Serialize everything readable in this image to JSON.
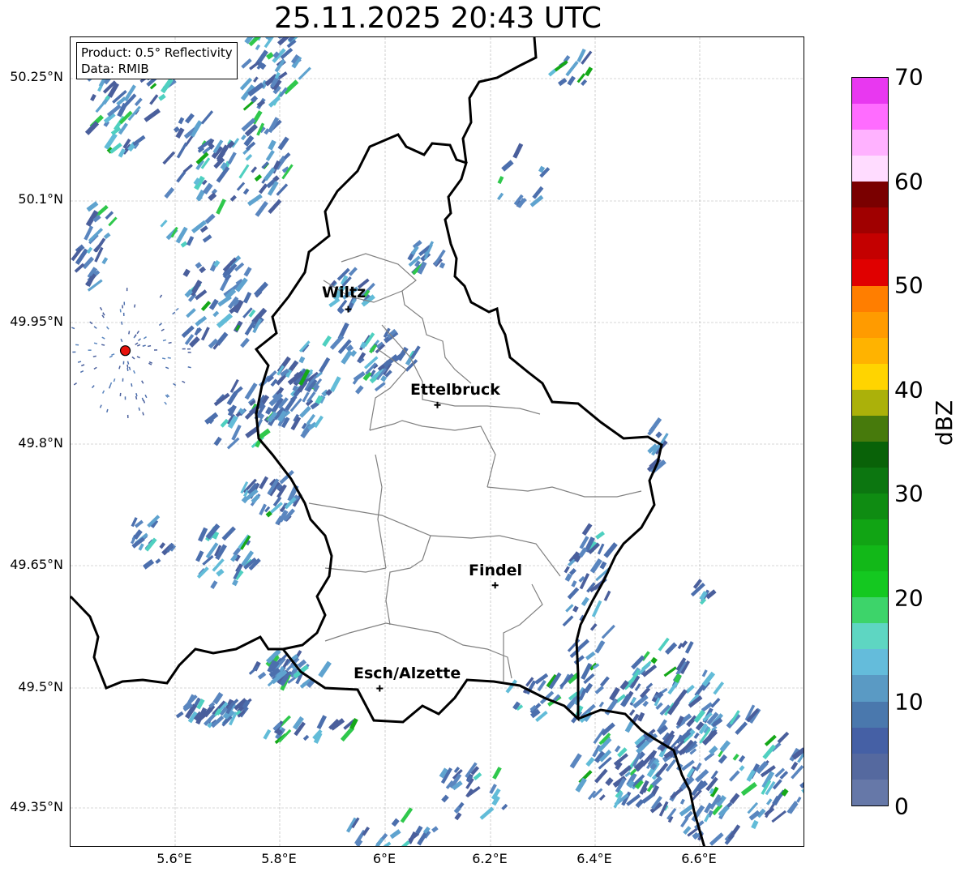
{
  "title": "25.11.2025 20:43 UTC",
  "info": {
    "product": "Product: 0.5° Reflectivity",
    "data_source": "Data: RMIB"
  },
  "cities": [
    {
      "name": "Wiltz",
      "lon": 5.93,
      "lat": 49.966
    },
    {
      "name": "Ettelbruck",
      "lon": 6.1,
      "lat": 49.848
    },
    {
      "name": "Findel",
      "lon": 6.21,
      "lat": 49.626
    },
    {
      "name": "Esch/Alzette",
      "lon": 5.99,
      "lat": 49.499
    }
  ],
  "radar_site": {
    "lon": 5.505,
    "lat": 49.915,
    "color": "#e8120c"
  },
  "lat_labels": [
    "50.25°N",
    "50.1°N",
    "49.95°N",
    "49.8°N",
    "49.65°N",
    "49.5°N",
    "49.35°N"
  ],
  "lon_labels": [
    "5.6°E",
    "5.8°E",
    "6°E",
    "6.2°E",
    "6.4°E",
    "6.6°E"
  ],
  "colorbar": {
    "label": "dBZ",
    "ticks": [
      "0",
      "10",
      "20",
      "30",
      "40",
      "50",
      "60",
      "70"
    ],
    "colors": [
      "#6678a8",
      "#55699f",
      "#4560a5",
      "#4a78ad",
      "#5a9ac4",
      "#64bcdb",
      "#5ed6c2",
      "#3dd46a",
      "#14c820",
      "#12b818",
      "#11a414",
      "#0f8c12",
      "#0c7610",
      "#096208",
      "#477a0c",
      "#abb10a",
      "#ffd400",
      "#ffb300",
      "#ff9b00",
      "#ff7e00",
      "#e00000",
      "#c40000",
      "#a00000",
      "#7a0000",
      "#ffdcff",
      "#ffb2ff",
      "#ff6cff",
      "#e838f0"
    ]
  },
  "colors": {
    "border": "#000000",
    "canton": "#808080",
    "grid": "#b0b0b0"
  }
}
